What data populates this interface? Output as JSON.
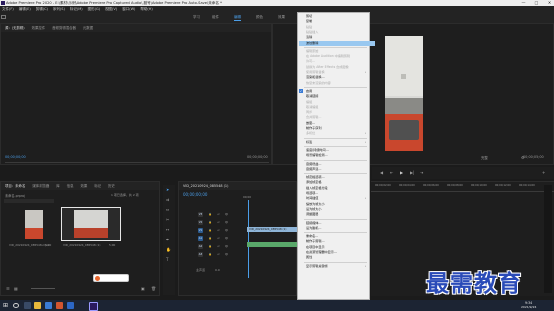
{
  "window": {
    "title": "Adobe Premiere Pro 2020 - E:\\素材\\示例\\Adobe Premiere Pro Captured Audio\\ 副号\\Adobe Premiere Pro Auto-Save\\未命名 *",
    "minimize": "—",
    "maximize": "□",
    "close": "✕"
  },
  "menubar": [
    "文件(F)",
    "编辑(E)",
    "剪辑(C)",
    "序列(S)",
    "标记(M)",
    "图形(G)",
    "视图(V)",
    "窗口(W)",
    "帮助(H)"
  ],
  "workspaces": {
    "tabs": [
      "学习",
      "组件",
      "编辑",
      "颜色",
      "效果",
      "音频",
      "图形",
      "库",
      "»"
    ],
    "active": "编辑"
  },
  "source_panel": {
    "tabs": [
      "源：(无剪辑)",
      "效果控件",
      "音频剪辑混合器",
      "元数据"
    ],
    "timecode_left": "00;00;00;00",
    "timecode_right": "00;00;00;00"
  },
  "program_panel": {
    "fit": "完整",
    "timecode": "00;00;00;00",
    "duration": "00;00;05;00"
  },
  "project_panel": {
    "tabs": [
      "项目：未命名",
      "媒体浏览器",
      "库",
      "信息",
      "效果",
      "标记",
      "历史"
    ],
    "project_name": "未命名.prproj",
    "item_count": "1 项已选择，共 2 项",
    "items": [
      {
        "name": "VID_20210924_085548.mp4",
        "duration": "5;00"
      },
      {
        "name": "VID_20210924_085548 (1)",
        "duration": "5;00"
      }
    ]
  },
  "timeline": {
    "sequence_tab": "VID_20210924_085548 (1)",
    "timecode": "00;00;00;00",
    "ruler": [
      "00;00",
      "00;00;02;00",
      "00;00;04;00",
      "00;00;06;00",
      "00;00;08;00",
      "00;00;10;00",
      "00;00;12;00",
      "00;00;14;00"
    ],
    "tracks": [
      "V3",
      "V2",
      "V1",
      "A1",
      "A2",
      "A3"
    ],
    "master": "主声道",
    "master_value": "0.0",
    "clips": [
      {
        "label": "VID_20210924_085548 (1)",
        "track": "V1"
      },
      {
        "label": "",
        "track": "A1"
      }
    ]
  },
  "context_menu": {
    "items": [
      {
        "label": "剪切",
        "state": "normal"
      },
      {
        "label": "复制",
        "state": "normal"
      },
      {
        "label": "粘贴",
        "state": "disabled"
      },
      {
        "label": "粘贴插入",
        "state": "disabled"
      },
      {
        "label": "清除",
        "state": "normal"
      },
      {
        "label": "波纹删除",
        "state": "highlighted"
      },
      {
        "label": "sep"
      },
      {
        "label": "编辑原始",
        "state": "disabled"
      },
      {
        "label": "在 Adobe Audition 中编辑剪辑",
        "state": "disabled"
      },
      {
        "label": "许可…",
        "state": "disabled"
      },
      {
        "label": "替换为 After Effects 合成图像",
        "state": "disabled"
      },
      {
        "label": "使用剪辑替换",
        "state": "disabled",
        "arrow": "›"
      },
      {
        "label": "渲染和替换…",
        "state": "normal"
      },
      {
        "label": "恢复未渲染的内容",
        "state": "disabled"
      },
      {
        "label": "sep"
      },
      {
        "label": "启用",
        "state": "checked"
      },
      {
        "label": "取消链接",
        "state": "normal"
      },
      {
        "label": "编组",
        "state": "disabled"
      },
      {
        "label": "取消编组",
        "state": "disabled"
      },
      {
        "label": "同步",
        "state": "disabled"
      },
      {
        "label": "合并剪辑…",
        "state": "disabled"
      },
      {
        "label": "嵌套…",
        "state": "normal"
      },
      {
        "label": "制作子序列",
        "state": "normal"
      },
      {
        "label": "多机位",
        "state": "disabled",
        "arrow": "›"
      },
      {
        "label": "sep"
      },
      {
        "label": "标签",
        "state": "normal",
        "arrow": "›"
      },
      {
        "label": "sep"
      },
      {
        "label": "速度/持续时间…",
        "state": "normal"
      },
      {
        "label": "场景编辑检测…",
        "state": "normal"
      },
      {
        "label": "sep"
      },
      {
        "label": "音频增益…",
        "state": "normal"
      },
      {
        "label": "音频声道…",
        "state": "normal"
      },
      {
        "label": "sep"
      },
      {
        "label": "帧定格选项…",
        "state": "normal"
      },
      {
        "label": "添加帧定格",
        "state": "normal"
      },
      {
        "label": "插入帧定格分段",
        "state": "normal"
      },
      {
        "label": "场选项…",
        "state": "normal"
      },
      {
        "label": "时间插值",
        "state": "normal",
        "arrow": "›"
      },
      {
        "label": "缩放为帧大小",
        "state": "normal"
      },
      {
        "label": "设为帧大小",
        "state": "normal"
      },
      {
        "label": "调整图层",
        "state": "normal"
      },
      {
        "label": "sep"
      },
      {
        "label": "链接媒体…",
        "state": "normal"
      },
      {
        "label": "设为脱机…",
        "state": "normal"
      },
      {
        "label": "sep"
      },
      {
        "label": "重命名…",
        "state": "normal"
      },
      {
        "label": "制作子剪辑…",
        "state": "normal"
      },
      {
        "label": "在项目中显示",
        "state": "normal"
      },
      {
        "label": "在资源管理器中显示…",
        "state": "normal"
      },
      {
        "label": "属性",
        "state": "normal"
      },
      {
        "label": "sep"
      },
      {
        "label": "显示剪辑关键帧",
        "state": "normal",
        "arrow": "›"
      }
    ]
  },
  "taskbar": {
    "time": "9:34",
    "date": "2021/9/24"
  },
  "watermark": "最需教育",
  "colors": {
    "accent": "#4b9ee8",
    "menu_highlight": "#99c8f0",
    "clip_video": "#8fb5d8",
    "clip_audio": "#5aa86a"
  }
}
